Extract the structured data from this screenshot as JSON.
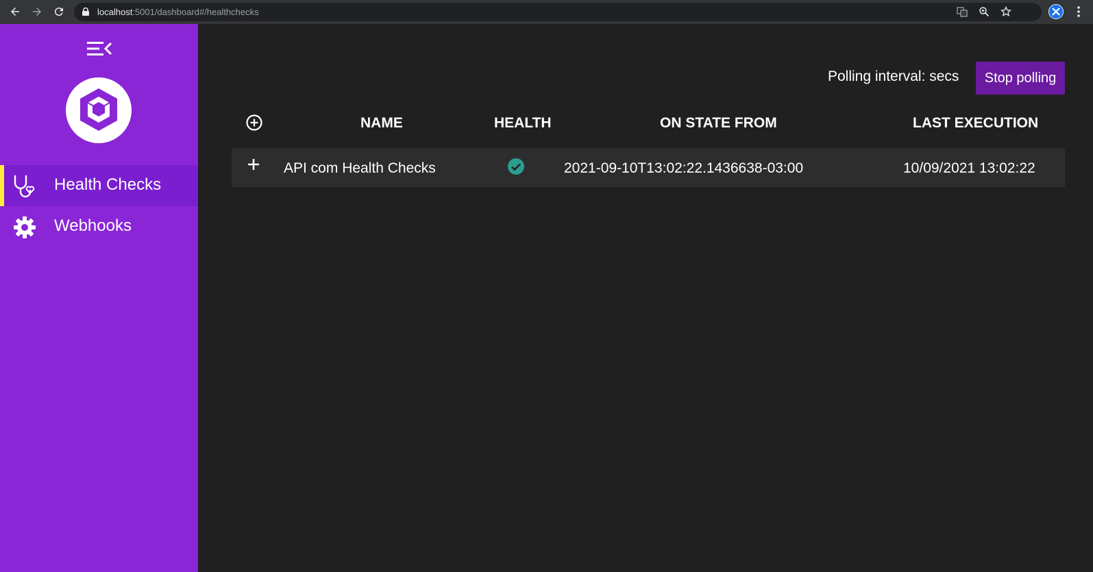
{
  "browser": {
    "url_host": "localhost",
    "url_rest": ":5001/dashboard#/healthchecks"
  },
  "sidebar": {
    "items": [
      {
        "label": "Health Checks",
        "icon": "stethoscope-icon",
        "active": true
      },
      {
        "label": "Webhooks",
        "icon": "gear-icon",
        "active": false
      }
    ]
  },
  "polling": {
    "label": "Polling interval: secs",
    "button_label": "Stop polling"
  },
  "table": {
    "headers": [
      "NAME",
      "HEALTH",
      "ON STATE FROM",
      "LAST EXECUTION"
    ],
    "rows": [
      {
        "name": "API com Health Checks",
        "health": "healthy",
        "on_state_from": "2021-09-10T13:02:22.1436638-03:00",
        "last_execution": "10/09/2021 13:02:22"
      }
    ]
  },
  "colors": {
    "sidebar": "#8a26d6",
    "active_indicator": "#ffeb3b",
    "button": "#6a1ba0",
    "healthy": "#2a9d8f",
    "background": "#202020"
  }
}
